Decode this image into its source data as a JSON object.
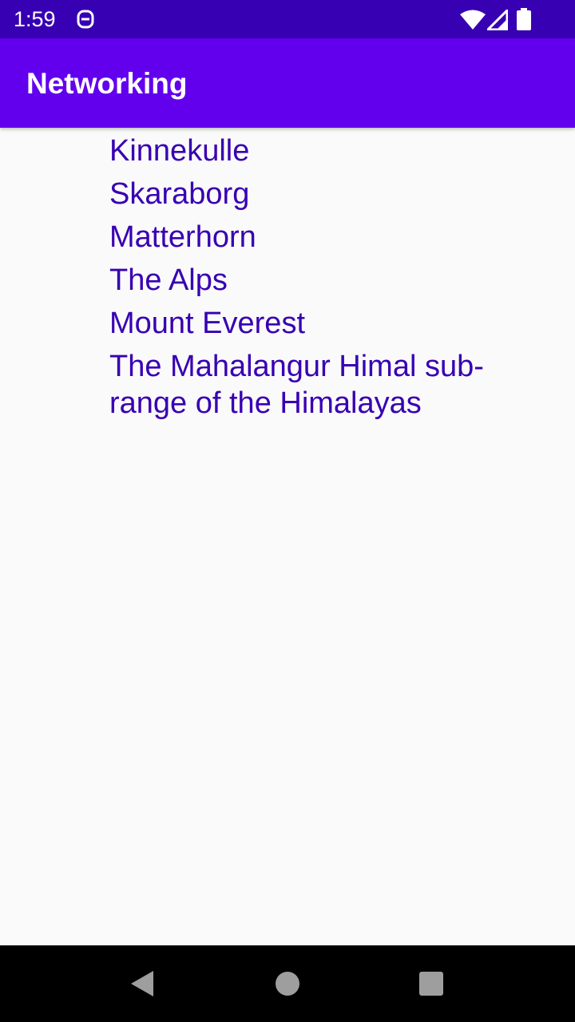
{
  "status_bar": {
    "time": "1:59",
    "icons": [
      "notification-icon",
      "wifi-icon",
      "signal-icon",
      "battery-icon"
    ]
  },
  "app_bar": {
    "title": "Networking",
    "color": "#6200ee"
  },
  "list": {
    "items": [
      "Kinnekulle",
      "Skaraborg",
      "Matterhorn",
      "The Alps",
      "Mount Everest",
      "The Mahalangur Himal sub-range of the Himalayas"
    ],
    "text_color": "#3700b3"
  },
  "nav_bar": {
    "icons": [
      "back-icon",
      "home-icon",
      "recents-icon"
    ]
  }
}
